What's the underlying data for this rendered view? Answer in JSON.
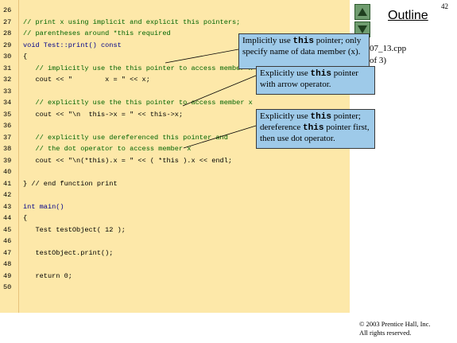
{
  "page_number": "42",
  "outline_label": "Outline",
  "file_name": "07_13.cpp",
  "file_pages": "of 3)",
  "copyright_line1": "© 2003 Prentice Hall, Inc.",
  "copyright_line2": "All rights reserved.",
  "code_lines": [
    {
      "n": "26",
      "t": "",
      "c": ""
    },
    {
      "n": "27",
      "t": "// print x using implicit and explicit this pointers;",
      "c": "cm"
    },
    {
      "n": "28",
      "t": "// parentheses around *this required",
      "c": "cm"
    },
    {
      "n": "29",
      "t": "void Test::print() const",
      "c": "kw"
    },
    {
      "n": "30",
      "t": "{",
      "c": ""
    },
    {
      "n": "31",
      "t": "   // implicitly use the this pointer to access member x",
      "c": "cm"
    },
    {
      "n": "32",
      "t": "   cout << \"        x = \" << x;",
      "c": ""
    },
    {
      "n": "33",
      "t": "",
      "c": ""
    },
    {
      "n": "34",
      "t": "   // explicitly use the this pointer to access member x",
      "c": "cm"
    },
    {
      "n": "35",
      "t": "   cout << \"\\n  this->x = \" << this->x;",
      "c": ""
    },
    {
      "n": "36",
      "t": "",
      "c": ""
    },
    {
      "n": "37",
      "t": "   // explicitly use dereferenced this pointer and",
      "c": "cm"
    },
    {
      "n": "38",
      "t": "   // the dot operator to access member x",
      "c": "cm"
    },
    {
      "n": "39",
      "t": "   cout << \"\\n(*this).x = \" << ( *this ).x << endl;",
      "c": ""
    },
    {
      "n": "40",
      "t": "",
      "c": ""
    },
    {
      "n": "41",
      "t": "} // end function print",
      "c": ""
    },
    {
      "n": "42",
      "t": "",
      "c": ""
    },
    {
      "n": "43",
      "t": "int main()",
      "c": "kw"
    },
    {
      "n": "44",
      "t": "{",
      "c": ""
    },
    {
      "n": "45",
      "t": "   Test testObject( 12 );",
      "c": ""
    },
    {
      "n": "46",
      "t": "",
      "c": ""
    },
    {
      "n": "47",
      "t": "   testObject.print();",
      "c": ""
    },
    {
      "n": "48",
      "t": "",
      "c": ""
    },
    {
      "n": "49",
      "t": "   return 0;",
      "c": ""
    },
    {
      "n": "50",
      "t": "",
      "c": ""
    }
  ],
  "callouts": [
    {
      "pre": "Implicitly use ",
      "code": "this",
      "post": " pointer; only specify name of data member (x)."
    },
    {
      "pre": "Explicitly use ",
      "code": "this",
      "post": " pointer with arrow operator."
    },
    {
      "pre": "Explicitly use ",
      "code": "this",
      "post": " pointer; dereference ",
      "code2": "this",
      "post2": " pointer first, then use dot operator."
    }
  ],
  "colors": {
    "code_bg": "#fde8a9",
    "callout_bg": "#9ecae9",
    "nav_btn": "#6f9c6f"
  },
  "icons": {
    "prev": "triangle-up-icon",
    "next": "triangle-down-icon"
  }
}
